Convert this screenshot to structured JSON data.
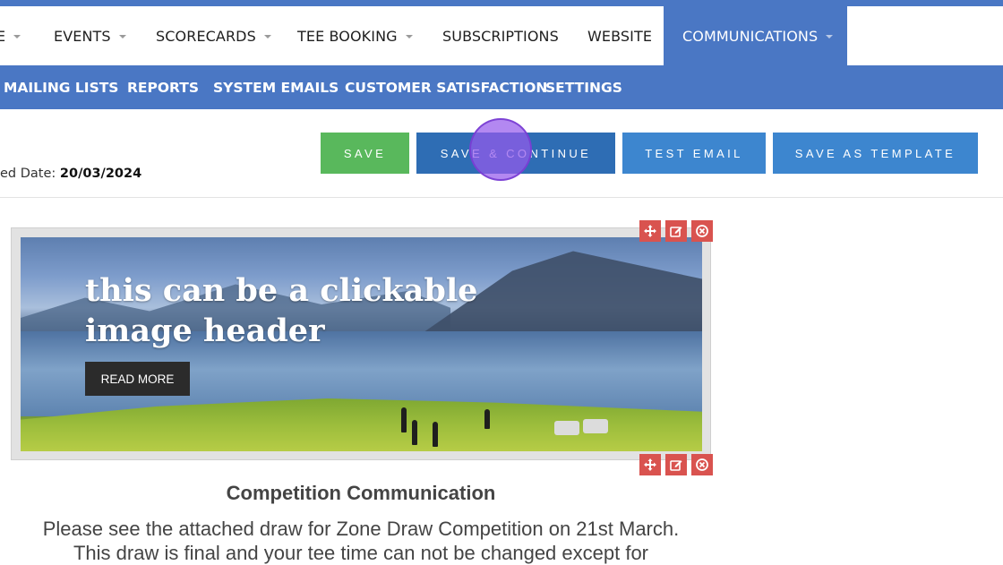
{
  "top_nav": {
    "items": [
      {
        "label": "E",
        "has_caret": true
      },
      {
        "label": "EVENTS",
        "has_caret": true
      },
      {
        "label": "SCORECARDS",
        "has_caret": true
      },
      {
        "label": "TEE BOOKING",
        "has_caret": true
      },
      {
        "label": "SUBSCRIPTIONS",
        "has_caret": false
      },
      {
        "label": "WEBSITE",
        "has_caret": false
      },
      {
        "label": "COMMUNICATIONS",
        "has_caret": true,
        "active": true
      }
    ]
  },
  "sub_nav": {
    "items": [
      {
        "label": "MAILING LISTS"
      },
      {
        "label": "REPORTS"
      },
      {
        "label": "SYSTEM EMAILS"
      },
      {
        "label": "CUSTOMER SATISFACTION"
      },
      {
        "label": "SETTINGS"
      }
    ]
  },
  "toolbar": {
    "date_prefix": "ed Date: ",
    "date_value": "20/03/2024",
    "save_label": "SAVE",
    "save_continue_label": "SAVE & CONTINUE",
    "test_email_label": "TEST EMAIL",
    "save_template_label": "SAVE AS TEMPLATE"
  },
  "editor": {
    "image_header": {
      "headline_line1": "this can be a clickable",
      "headline_line2": "image header",
      "button_label": "READ MORE"
    },
    "controls": [
      "move-icon",
      "edit-icon",
      "delete-icon"
    ],
    "title": "Competition Communication",
    "body_line1": "Please see the attached draw for Zone Draw Competition on 21st March.",
    "body_line2": "This draw is final and your tee time can not be changed except for"
  },
  "colors": {
    "nav_blue": "#4a77c4",
    "save_green": "#59b85c",
    "save_continue_blue": "#2e6db4",
    "button_blue": "#3d86cf",
    "control_red": "#d9534f"
  }
}
